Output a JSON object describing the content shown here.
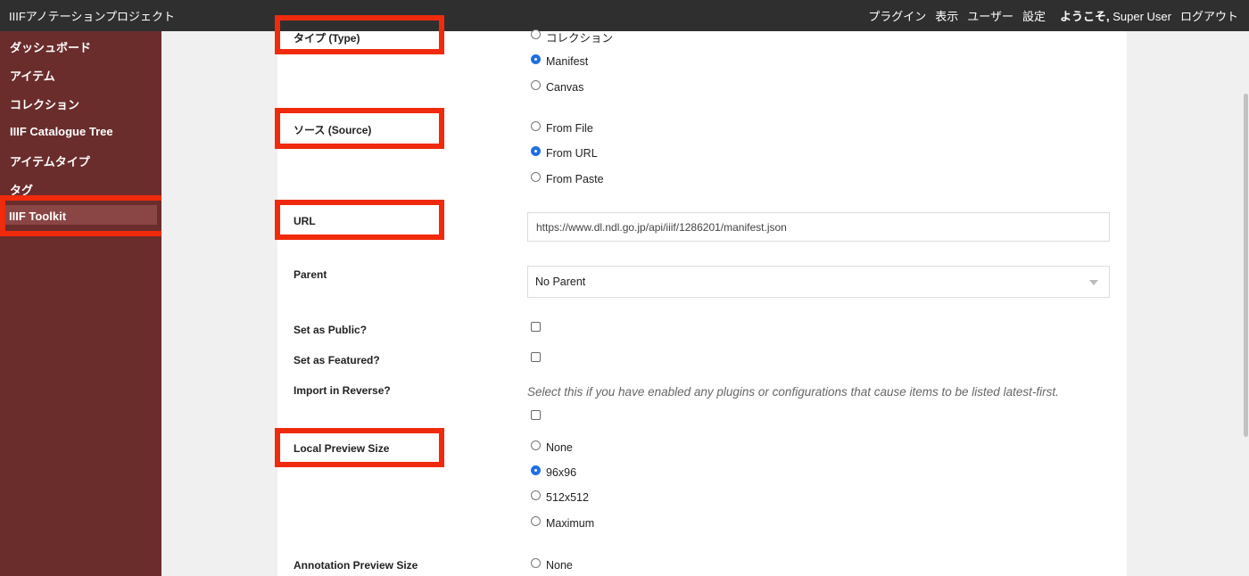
{
  "header": {
    "site_title": "IIIFアノテーションプロジェクト",
    "nav": [
      "プラグイン",
      "表示",
      "ユーザー",
      "設定"
    ],
    "welcome": "ようこそ,",
    "user_name": "Super User",
    "logout": "ログアウト"
  },
  "sidebar": {
    "items": [
      {
        "label": "ダッシュボード"
      },
      {
        "label": "アイテム"
      },
      {
        "label": "コレクション"
      },
      {
        "label": "IIIF Catalogue Tree"
      },
      {
        "label": "アイテムタイプ"
      },
      {
        "label": "タグ"
      },
      {
        "label": "IIIF Toolkit",
        "active": true
      }
    ]
  },
  "form": {
    "type": {
      "label": "タイプ (Type)",
      "options": [
        "コレクション",
        "Manifest",
        "Canvas"
      ],
      "selected": "Manifest"
    },
    "source": {
      "label": "ソース (Source)",
      "options": [
        "From File",
        "From URL",
        "From Paste"
      ],
      "selected": "From URL"
    },
    "url": {
      "label": "URL",
      "value": "https://www.dl.ndl.go.jp/api/iiif/1286201/manifest.json"
    },
    "parent": {
      "label": "Parent",
      "value": "No Parent"
    },
    "public": {
      "label": "Set as Public?",
      "checked": false
    },
    "featured": {
      "label": "Set as Featured?",
      "checked": false
    },
    "reverse": {
      "label": "Import in Reverse?",
      "hint": "Select this if you have enabled any plugins or configurations that cause items to be listed latest-first.",
      "checked": false
    },
    "local_preview": {
      "label": "Local Preview Size",
      "options": [
        "None",
        "96x96",
        "512x512",
        "Maximum"
      ],
      "selected": "96x96"
    },
    "annotation_preview": {
      "label": "Annotation Preview Size",
      "options": [
        "None"
      ]
    }
  },
  "colors": {
    "topbar": "#2f2f2f",
    "sidebar": "#6a2d2c",
    "sidebar_active": "#8a4644",
    "highlight_box": "#f02a0c",
    "radio_checked": "#1e6fe3"
  }
}
